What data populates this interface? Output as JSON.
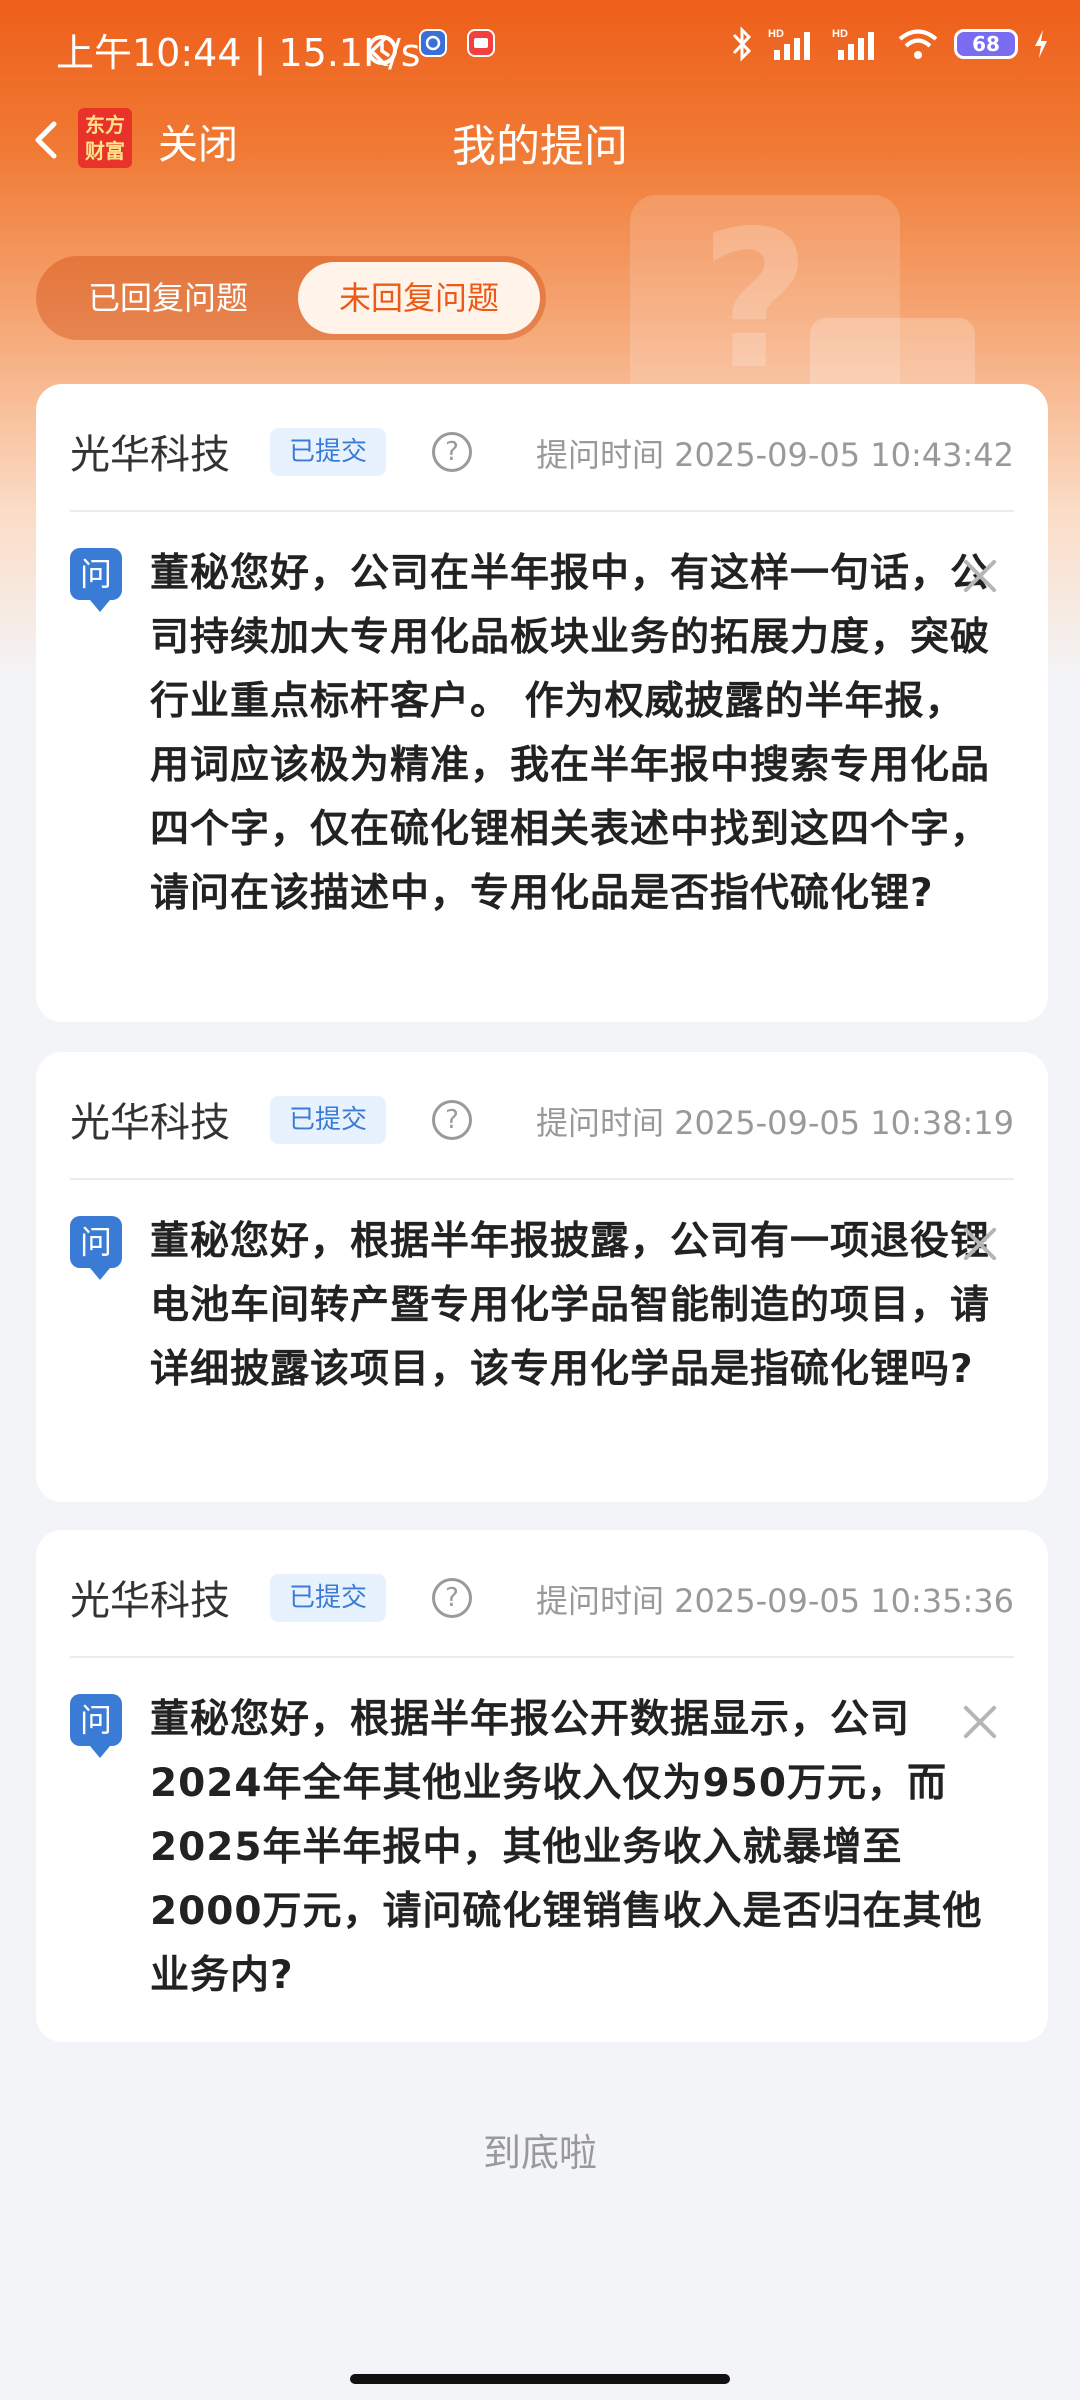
{
  "status_bar": {
    "time": "上午10:44 | 15.1K/s",
    "battery": "68"
  },
  "nav": {
    "close_label": "关闭",
    "title": "我的提问",
    "logo_text": "东方财富"
  },
  "tabs": [
    {
      "label": "已回复问题",
      "active": false
    },
    {
      "label": "未回复问题",
      "active": true
    }
  ],
  "questions": [
    {
      "company": "光华科技",
      "status": "已提交",
      "time_label": "提问时间",
      "time": "2025-09-05 10:43:42",
      "icon_label": "问",
      "text": "董秘您好，公司在半年报中，有这样一句话，公司持续加大专用化品板块业务的拓展力度，突破行业重点标杆客户。 作为权威披露的半年报，用词应该极为精准，我在半年报中搜索专用化品四个字，仅在硫化锂相关表述中找到这四个字，请问在该描述中，专用化品是否指代硫化锂?"
    },
    {
      "company": "光华科技",
      "status": "已提交",
      "time_label": "提问时间",
      "time": "2025-09-05 10:38:19",
      "icon_label": "问",
      "text": "董秘您好，根据半年报披露，公司有一项退役锂电池车间转产暨专用化学品智能制造的项目，请详细披露该项目，该专用化学品是指硫化锂吗?"
    },
    {
      "company": "光华科技",
      "status": "已提交",
      "time_label": "提问时间",
      "time": "2025-09-05 10:35:36",
      "icon_label": "问",
      "text": "董秘您好，根据半年报公开数据显示，公司2024年全年其他业务收入仅为950万元，而2025年半年报中，其他业务收入就暴增至2000万元，请问硫化锂销售收入是否归在其他业务内?"
    }
  ],
  "footer": {
    "end_text": "到底啦"
  },
  "colors": {
    "brand_orange": "#ee5f1a",
    "badge_blue": "#3a7bd5"
  }
}
